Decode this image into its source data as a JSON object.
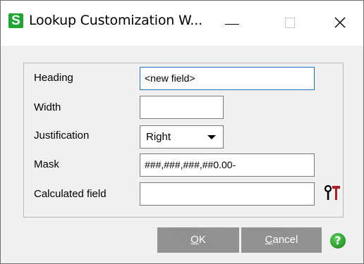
{
  "window": {
    "app_icon_letter": "S",
    "title": "Lookup Customization W...",
    "accent_color": "#21a531"
  },
  "form": {
    "heading": {
      "label": "Heading",
      "value": "<new field>"
    },
    "width": {
      "label": "Width",
      "value": ""
    },
    "justification": {
      "label": "Justification",
      "value": "Right"
    },
    "mask": {
      "label": "Mask",
      "value": "###,###,###,##0.00-"
    },
    "calculated_field": {
      "label": "Calculated field",
      "value": ""
    }
  },
  "buttons": {
    "ok_mnemonic": "O",
    "ok_rest": "K",
    "cancel_mnemonic": "C",
    "cancel_rest": "ancel",
    "help_glyph": "?"
  },
  "icons": {
    "app": "sage-s-icon",
    "minimize": "minimize-icon",
    "maximize": "maximize-icon",
    "close": "close-icon",
    "tools": "tools-icon",
    "help": "help-icon"
  }
}
